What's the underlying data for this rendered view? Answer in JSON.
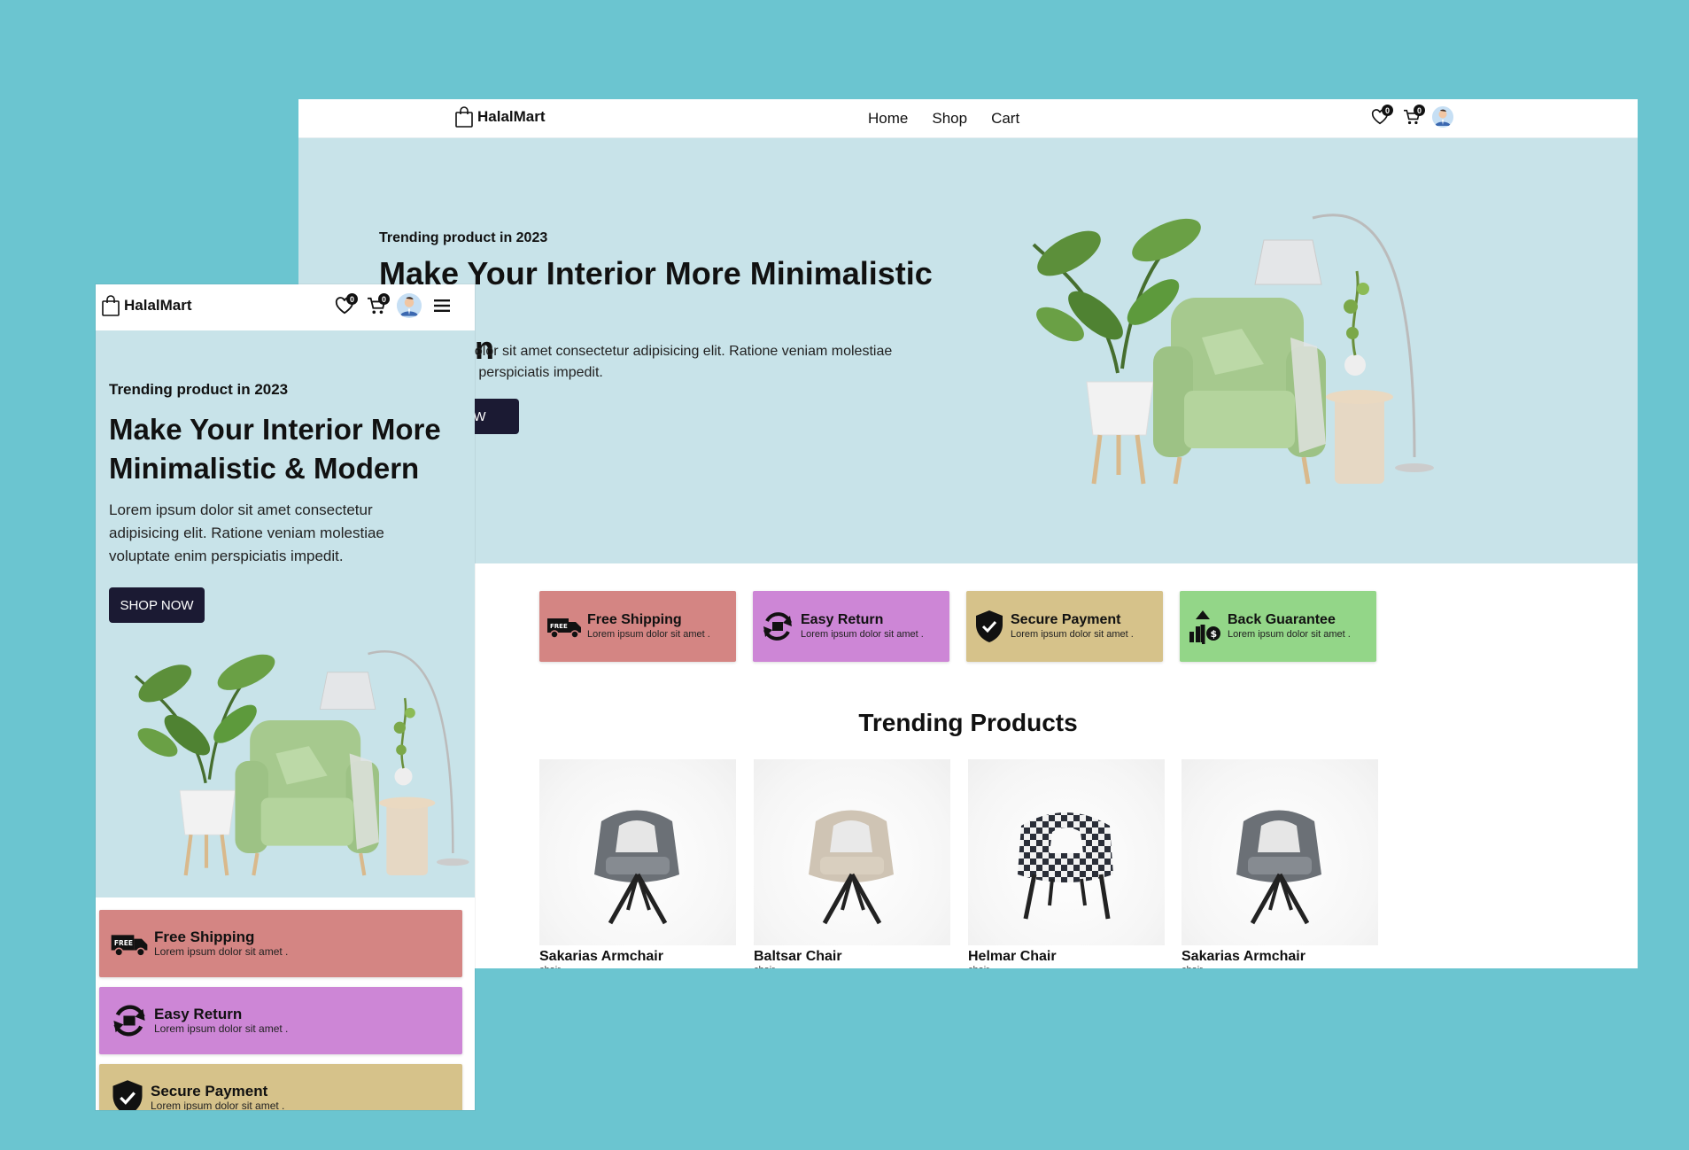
{
  "brand": {
    "name": "HalalMart"
  },
  "nav": {
    "links": [
      "Home",
      "Shop",
      "Cart"
    ],
    "wishlist_count": "0",
    "cart_count": "0"
  },
  "hero": {
    "eyebrow": "Trending product in 2023",
    "title_desktop_visible": "Make Your Interior More Minimalistic &",
    "title_desktop_line2": "n",
    "title": "Make Your Interior More Minimalistic & Modern",
    "desc_desktop_line1": "dolor sit amet consectetur adipisicing elit. Ratione veniam molestiae",
    "desc_desktop_line2": "n perspiciatis impedit.",
    "description": "Lorem ipsum dolor sit amet consectetur adipisicing elit. Ratione veniam molestiae voluptate enim perspiciatis impedit.",
    "cta": "SHOP NOW"
  },
  "features": [
    {
      "title": "Free Shipping",
      "subtitle": "Lorem ipsum dolor sit amet .",
      "color": "#d48583",
      "icon": "truck-icon"
    },
    {
      "title": "Easy Return",
      "subtitle": "Lorem ipsum dolor sit amet .",
      "color": "#cd86d6",
      "icon": "return-icon"
    },
    {
      "title": "Secure Payment",
      "subtitle": "Lorem ipsum dolor sit amet .",
      "color": "#d6c28a",
      "icon": "shield-check-icon"
    },
    {
      "title": "Back Guarantee",
      "subtitle": "Lorem ipsum dolor sit amet .",
      "color": "#93d688",
      "icon": "money-back-icon"
    }
  ],
  "trending": {
    "heading": "Trending Products",
    "products": [
      {
        "name": "Sakarias Armchair",
        "category": "chair"
      },
      {
        "name": "Baltsar Chair",
        "category": "chair"
      },
      {
        "name": "Helmar Chair",
        "category": "chair"
      },
      {
        "name": "Sakarias Armchair",
        "category": "chair"
      }
    ]
  }
}
